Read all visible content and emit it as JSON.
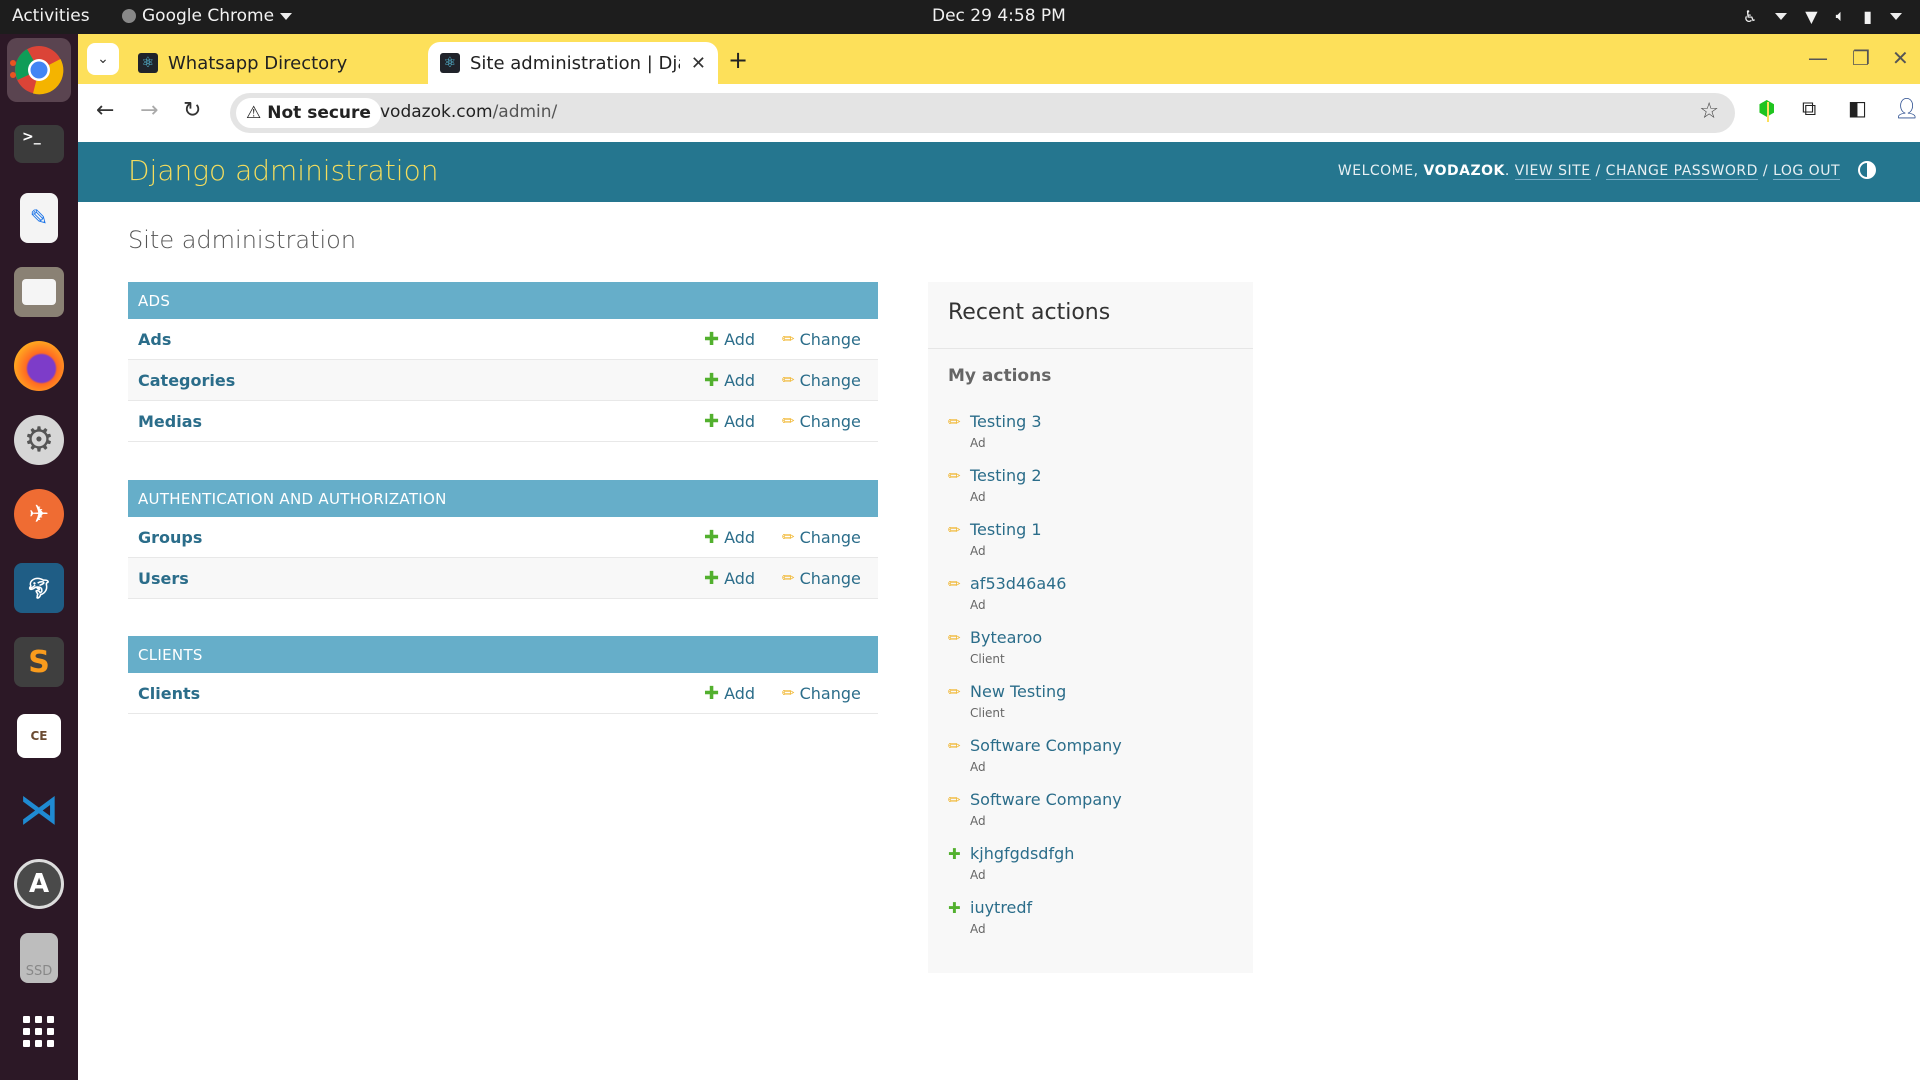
{
  "system": {
    "activities": "Activities",
    "app_menu": "Google Chrome",
    "clock": "Dec 29  4:58 PM"
  },
  "dock": {
    "items": [
      {
        "name": "google-chrome",
        "active": true
      },
      {
        "name": "terminal"
      },
      {
        "name": "text-editor"
      },
      {
        "name": "files"
      },
      {
        "name": "firefox"
      },
      {
        "name": "settings"
      },
      {
        "name": "postman"
      },
      {
        "name": "mysql-workbench"
      },
      {
        "name": "sublime-text"
      },
      {
        "name": "dbeaver-ce"
      },
      {
        "name": "vscode"
      },
      {
        "name": "software-updater"
      },
      {
        "name": "ssd-drive",
        "label": "SSD"
      },
      {
        "name": "show-applications"
      }
    ]
  },
  "browser": {
    "tabs": [
      {
        "title": "Whatsapp Directory",
        "active": false
      },
      {
        "title": "Site administration | Django site admin",
        "active": true
      }
    ],
    "security_label": "Not secure",
    "url_host": "vodazok.com",
    "url_path": "/admin/"
  },
  "admin": {
    "branding": "Django administration",
    "welcome_prefix": "WELCOME,",
    "username": "VODAZOK",
    "view_site": "VIEW SITE",
    "change_password": "CHANGE PASSWORD",
    "log_out": "LOG OUT",
    "page_title": "Site administration",
    "add_label": "Add",
    "change_label": "Change",
    "modules": [
      {
        "caption": "ADS",
        "models": [
          "Ads",
          "Categories",
          "Medias"
        ]
      },
      {
        "caption": "AUTHENTICATION AND AUTHORIZATION",
        "models": [
          "Groups",
          "Users"
        ]
      },
      {
        "caption": "CLIENTS",
        "models": [
          "Clients"
        ]
      }
    ],
    "recent": {
      "title": "Recent actions",
      "subtitle": "My actions",
      "items": [
        {
          "label": "Testing 3",
          "type": "Ad",
          "action": "change"
        },
        {
          "label": "Testing 2",
          "type": "Ad",
          "action": "change"
        },
        {
          "label": "Testing 1",
          "type": "Ad",
          "action": "change"
        },
        {
          "label": "af53d46a46",
          "type": "Ad",
          "action": "change"
        },
        {
          "label": "Bytearoo",
          "type": "Client",
          "action": "change"
        },
        {
          "label": "New Testing",
          "type": "Client",
          "action": "change"
        },
        {
          "label": "Software Company",
          "type": "Ad",
          "action": "change"
        },
        {
          "label": "Software Company",
          "type": "Ad",
          "action": "change"
        },
        {
          "label": "kjhgfgdsdfgh",
          "type": "Ad",
          "action": "addition"
        },
        {
          "label": "iuytredf",
          "type": "Ad",
          "action": "addition"
        }
      ]
    }
  },
  "colors": {
    "header_bg": "#25768f",
    "branding": "#f5dd5d",
    "caption_bg": "#66aec9",
    "link": "#2b6d8a",
    "add_icon": "#52b02e",
    "change_icon": "#f0b429",
    "chrome_frame": "#fde05a"
  }
}
